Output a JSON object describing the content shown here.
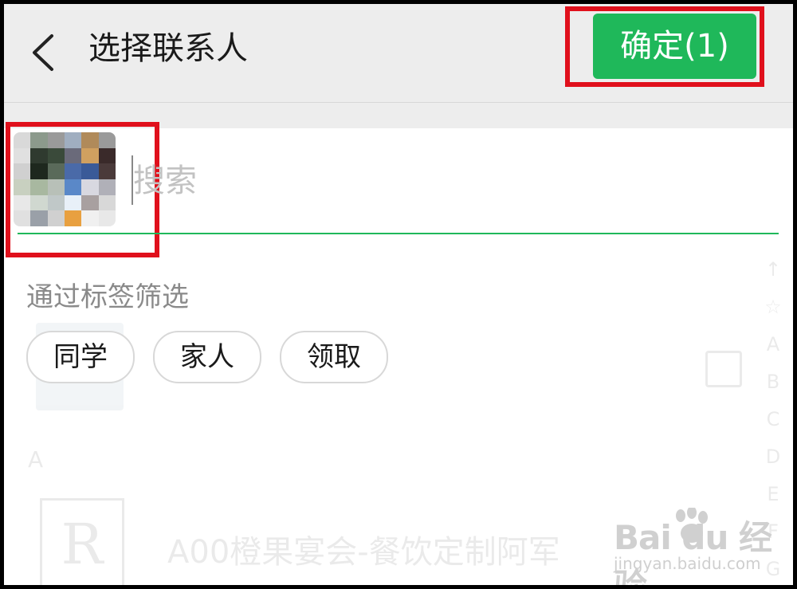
{
  "header": {
    "title": "选择联系人",
    "back_icon": "chevron-left-icon",
    "confirm_label": "确定(1)"
  },
  "search": {
    "placeholder": "搜索",
    "value": ""
  },
  "tags": {
    "label": "通过标签筛选",
    "items": [
      "同学",
      "家人",
      "领取"
    ]
  },
  "background_list": {
    "section_letter": "A",
    "contact_name": "A00橙果宴会-餐饮定制阿军",
    "avatar_letters": "R",
    "index_letters": [
      "↑",
      "☆",
      "A",
      "B",
      "C",
      "D",
      "E",
      "F",
      "G"
    ]
  },
  "watermark": {
    "main": "Bai du 经验",
    "sub": "jingyan.baidu.com"
  },
  "colors": {
    "accent_green": "#1fb85a",
    "highlight_red": "#e0101c",
    "header_bg": "#ededed"
  }
}
